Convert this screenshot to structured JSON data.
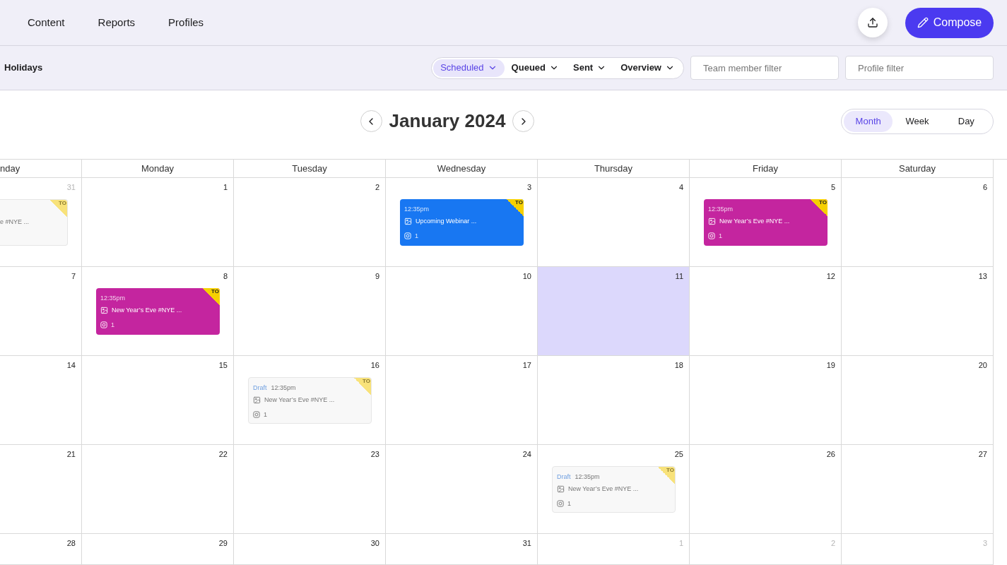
{
  "nav": {
    "items": [
      {
        "label": "Content"
      },
      {
        "label": "Reports"
      },
      {
        "label": "Profiles"
      }
    ],
    "compose": {
      "label": "Compose"
    }
  },
  "filters": {
    "holidays": "Holidays",
    "status_tabs": [
      {
        "label": "Scheduled",
        "selected": true
      },
      {
        "label": "Queued",
        "selected": false
      },
      {
        "label": "Sent",
        "selected": false
      },
      {
        "label": "Overview",
        "selected": false
      }
    ],
    "team_member": {
      "placeholder": "Team member filter"
    },
    "profile": {
      "placeholder": "Profile filter"
    }
  },
  "calendar": {
    "title": "January 2024",
    "view_tabs": [
      {
        "label": "Month",
        "selected": true
      },
      {
        "label": "Week",
        "selected": false
      },
      {
        "label": "Day",
        "selected": false
      }
    ],
    "weekdays": [
      "nday",
      "Monday",
      "Tuesday",
      "Wednesday",
      "Thursday",
      "Friday",
      "Saturday"
    ],
    "weeks": [
      {
        "days": [
          {
            "number": "31",
            "in_month": false,
            "selected": false,
            "events": [
              {
                "kind": "partial",
                "title": "e #NYE ...",
                "badge": "TO"
              }
            ]
          },
          {
            "number": "1",
            "in_month": true,
            "selected": false
          },
          {
            "number": "2",
            "in_month": true,
            "selected": false
          },
          {
            "number": "3",
            "in_month": true,
            "selected": false,
            "events": [
              {
                "kind": "scheduled",
                "color": "#1877f2",
                "time": "12:35pm",
                "title": "Upcoming Webinar ...",
                "count": "1",
                "badge": "TO"
              }
            ]
          },
          {
            "number": "4",
            "in_month": true,
            "selected": false
          },
          {
            "number": "5",
            "in_month": true,
            "selected": false,
            "events": [
              {
                "kind": "scheduled",
                "color": "#c4259f",
                "time": "12:35pm",
                "title": "New Year’s Eve #NYE ...",
                "count": "1",
                "badge": "TO"
              }
            ]
          },
          {
            "number": "6",
            "in_month": true,
            "selected": false
          }
        ]
      },
      {
        "days": [
          {
            "number": "7",
            "in_month": true,
            "selected": false
          },
          {
            "number": "8",
            "in_month": true,
            "selected": false,
            "events": [
              {
                "kind": "scheduled",
                "color": "#c4259f",
                "time": "12:35pm",
                "title": "New Year’s Eve #NYE ...",
                "count": "1",
                "badge": "TO"
              }
            ]
          },
          {
            "number": "9",
            "in_month": true,
            "selected": false
          },
          {
            "number": "10",
            "in_month": true,
            "selected": false
          },
          {
            "number": "11",
            "in_month": true,
            "selected": true
          },
          {
            "number": "12",
            "in_month": true,
            "selected": false
          },
          {
            "number": "13",
            "in_month": true,
            "selected": false
          }
        ]
      },
      {
        "days": [
          {
            "number": "14",
            "in_month": true,
            "selected": false
          },
          {
            "number": "15",
            "in_month": true,
            "selected": false
          },
          {
            "number": "16",
            "in_month": true,
            "selected": false,
            "events": [
              {
                "kind": "draft",
                "status": "Draft",
                "time": "12:35pm",
                "title": "New Year’s Eve #NYE ...",
                "count": "1",
                "badge": "TO"
              }
            ]
          },
          {
            "number": "17",
            "in_month": true,
            "selected": false
          },
          {
            "number": "18",
            "in_month": true,
            "selected": false
          },
          {
            "number": "19",
            "in_month": true,
            "selected": false
          },
          {
            "number": "20",
            "in_month": true,
            "selected": false
          }
        ]
      },
      {
        "days": [
          {
            "number": "21",
            "in_month": true,
            "selected": false
          },
          {
            "number": "22",
            "in_month": true,
            "selected": false
          },
          {
            "number": "23",
            "in_month": true,
            "selected": false
          },
          {
            "number": "24",
            "in_month": true,
            "selected": false
          },
          {
            "number": "25",
            "in_month": true,
            "selected": false,
            "events": [
              {
                "kind": "draft",
                "status": "Draft",
                "time": "12:35pm",
                "title": "New Year’s Eve #NYE ...",
                "count": "1",
                "badge": "TO"
              }
            ]
          },
          {
            "number": "26",
            "in_month": true,
            "selected": false
          },
          {
            "number": "27",
            "in_month": true,
            "selected": false
          }
        ]
      },
      {
        "days": [
          {
            "number": "28",
            "in_month": true,
            "selected": false
          },
          {
            "number": "29",
            "in_month": true,
            "selected": false
          },
          {
            "number": "30",
            "in_month": true,
            "selected": false
          },
          {
            "number": "31",
            "in_month": true,
            "selected": false
          },
          {
            "number": "1",
            "in_month": false,
            "selected": false
          },
          {
            "number": "2",
            "in_month": false,
            "selected": false
          },
          {
            "number": "3",
            "in_month": false,
            "selected": false
          }
        ]
      }
    ]
  }
}
